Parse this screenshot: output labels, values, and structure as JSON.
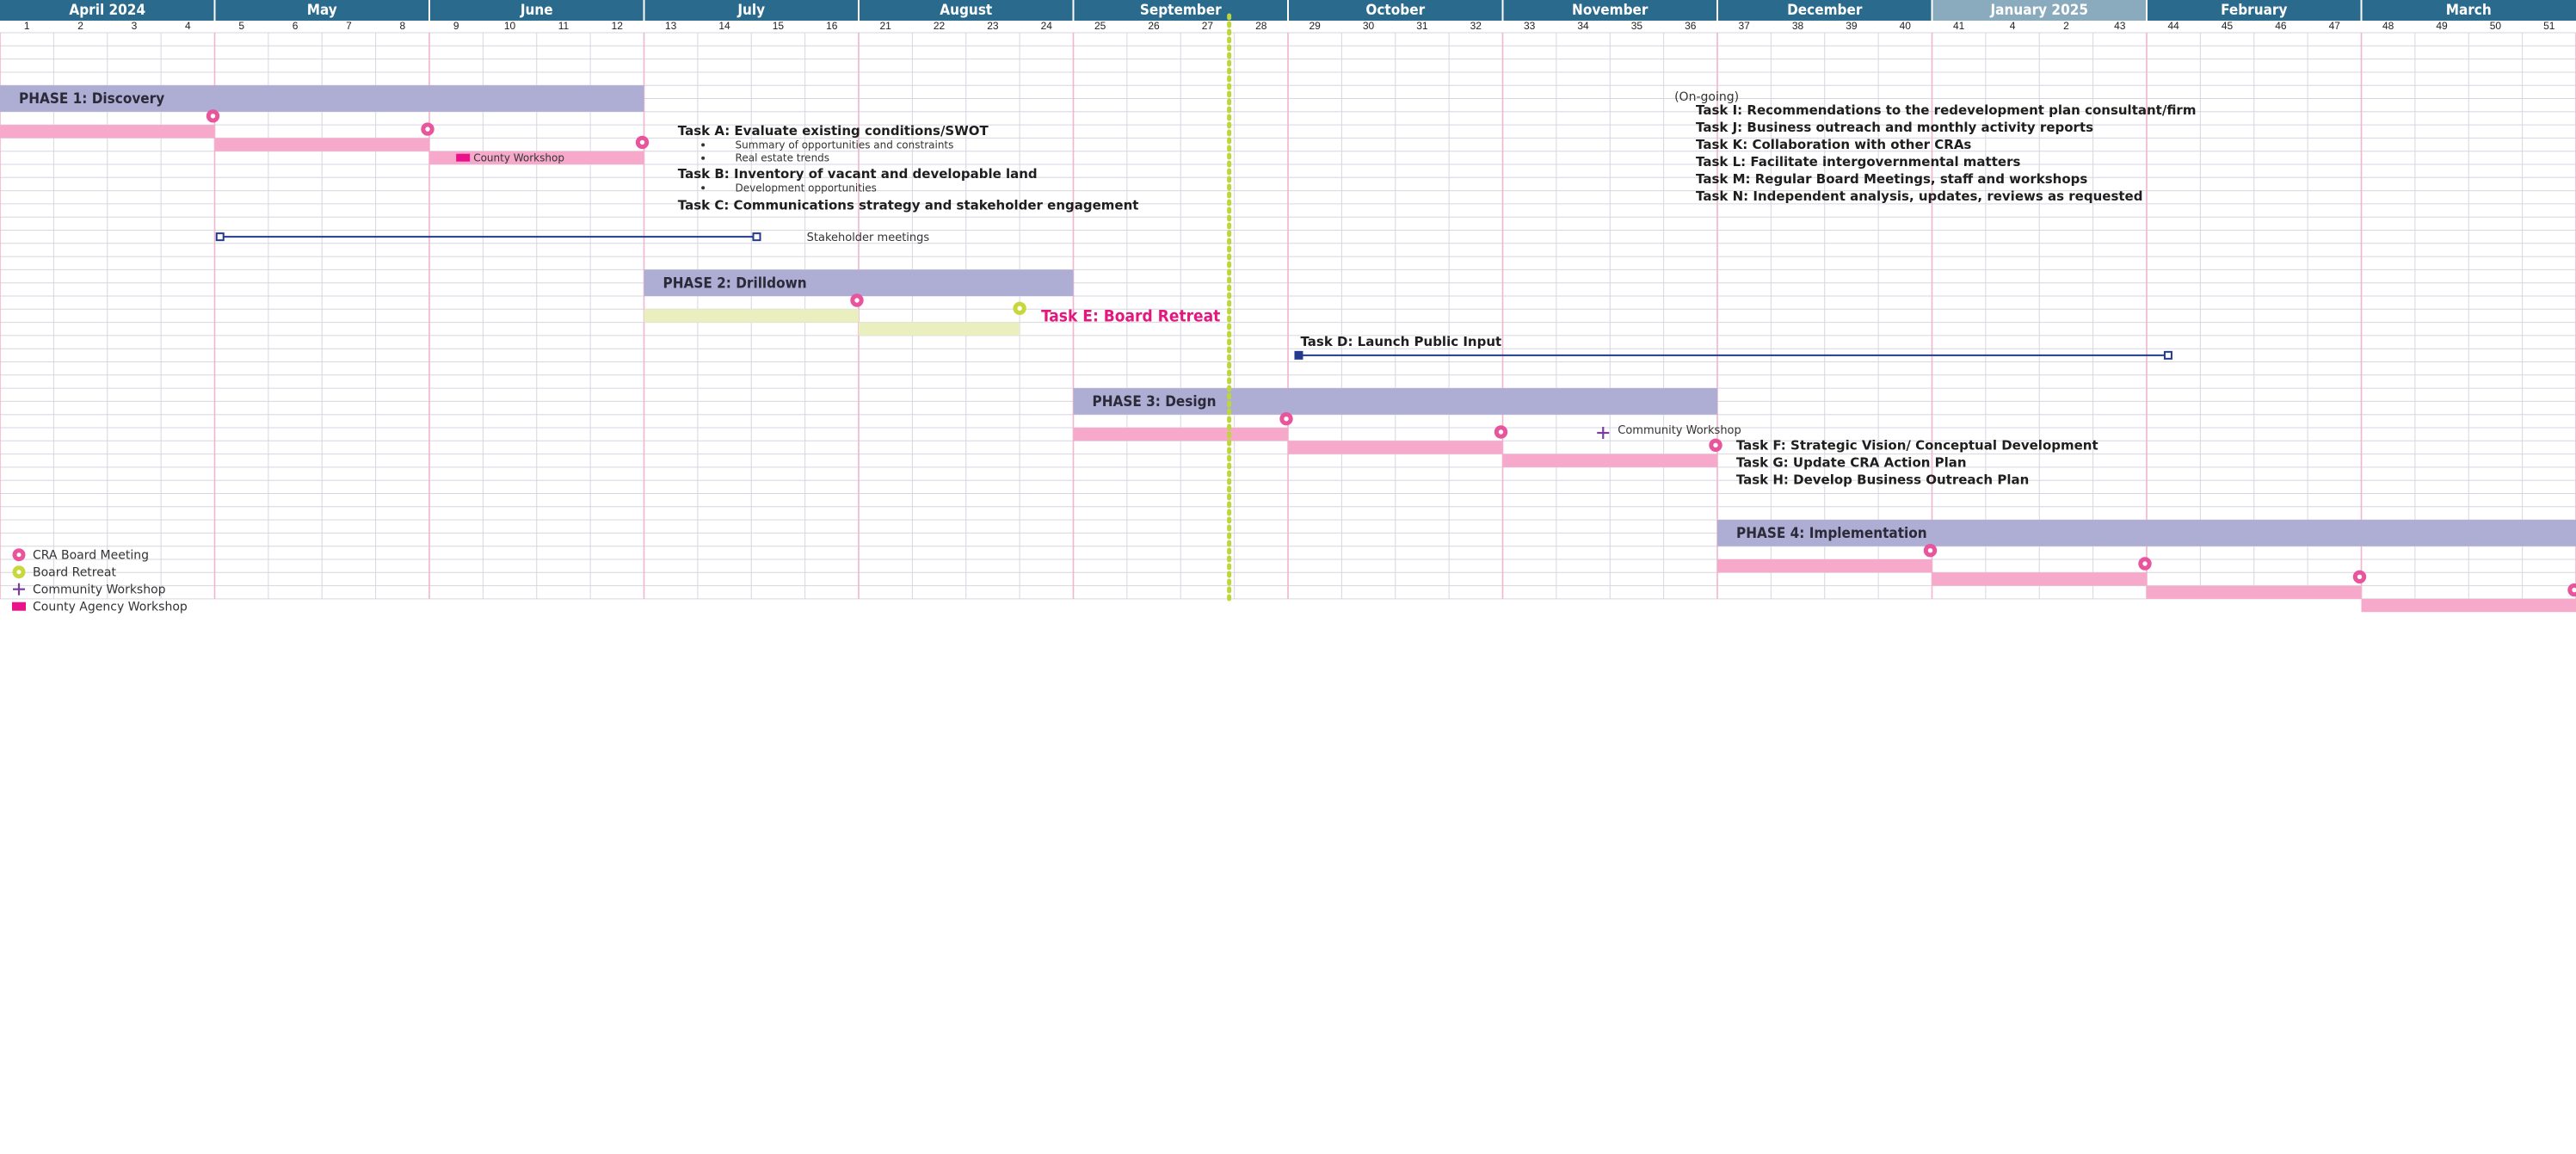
{
  "months": [
    {
      "label": "April 2024",
      "span": 4,
      "faded": false
    },
    {
      "label": "May",
      "span": 4,
      "faded": false
    },
    {
      "label": "June",
      "span": 4,
      "faded": false
    },
    {
      "label": "July",
      "span": 4,
      "faded": false
    },
    {
      "label": "August",
      "span": 4,
      "faded": false
    },
    {
      "label": "September",
      "span": 4,
      "faded": false
    },
    {
      "label": "October",
      "span": 4,
      "faded": false
    },
    {
      "label": "November",
      "span": 4,
      "faded": false
    },
    {
      "label": "December",
      "span": 4,
      "faded": false
    },
    {
      "label": "January 2025",
      "span": 4,
      "faded": true
    },
    {
      "label": "February",
      "span": 4,
      "faded": false
    },
    {
      "label": "March",
      "span": 4,
      "faded": false
    }
  ],
  "weeks": [
    "1",
    "2",
    "3",
    "4",
    "5",
    "6",
    "7",
    "8",
    "9",
    "10",
    "11",
    "12",
    "13",
    "14",
    "15",
    "16",
    "21",
    "22",
    "23",
    "24",
    "25",
    "26",
    "27",
    "28",
    "29",
    "30",
    "31",
    "32",
    "33",
    "34",
    "35",
    "36",
    "37",
    "38",
    "39",
    "40",
    "41",
    "4",
    "2",
    "43",
    "44",
    "45",
    "46",
    "47",
    "48",
    "49",
    "50",
    "51"
  ],
  "today_week": 23,
  "colors": {
    "header": "#2a6a8c",
    "header_faded": "#8aaabd",
    "phase": "#aeadd4",
    "meeting": "#e8559c",
    "meeting_bar": "#f7a9cb",
    "retreat": "#c8d83c",
    "retreat_bar": "#e9efbf",
    "community": "#7a3e9c",
    "county": "#e8128a",
    "line": "#233b8c",
    "today": "#bfd63a",
    "board_retreat_text": "#e3187f",
    "month_divider": "#f0b6cc",
    "grid": "#d6d6e0"
  },
  "phases": [
    {
      "label": "PHASE 1: Discovery",
      "start": 0,
      "end": 12,
      "row": 4
    },
    {
      "label": "PHASE 2: Drilldown",
      "start": 12,
      "end": 20,
      "row": 18
    },
    {
      "label": "PHASE 3: Design",
      "start": 20,
      "end": 32,
      "row": 27
    },
    {
      "label": "PHASE 4: Implementation",
      "start": 32,
      "end": 48,
      "row": 37
    }
  ],
  "bars": [
    {
      "start": 0,
      "end": 4,
      "row": 7,
      "kind": "meeting"
    },
    {
      "start": 4,
      "end": 8,
      "row": 8,
      "kind": "meeting"
    },
    {
      "start": 8,
      "end": 12,
      "row": 9,
      "kind": "meeting"
    },
    {
      "start": 12,
      "end": 16,
      "row": 21,
      "kind": "retreat"
    },
    {
      "start": 16,
      "end": 19,
      "row": 22,
      "kind": "retreat"
    },
    {
      "start": 20,
      "end": 24,
      "row": 30,
      "kind": "meeting"
    },
    {
      "start": 24,
      "end": 28,
      "row": 31,
      "kind": "meeting"
    },
    {
      "start": 28,
      "end": 32,
      "row": 32,
      "kind": "meeting"
    },
    {
      "start": 32,
      "end": 36,
      "row": 40,
      "kind": "meeting"
    },
    {
      "start": 36,
      "end": 40,
      "row": 41,
      "kind": "meeting"
    },
    {
      "start": 40,
      "end": 44,
      "row": 42,
      "kind": "meeting"
    },
    {
      "start": 44,
      "end": 48,
      "row": 43,
      "kind": "meeting"
    }
  ],
  "meetings": [
    {
      "week": 4,
      "row": 6
    },
    {
      "week": 8,
      "row": 7
    },
    {
      "week": 12,
      "row": 8
    },
    {
      "week": 16,
      "row": 20
    },
    {
      "week": 24,
      "row": 29
    },
    {
      "week": 28,
      "row": 30
    },
    {
      "week": 32,
      "row": 31
    },
    {
      "week": 36,
      "row": 39
    },
    {
      "week": 40,
      "row": 40
    },
    {
      "week": 44,
      "row": 41
    },
    {
      "week": 48,
      "row": 42
    }
  ],
  "retreats": [
    {
      "week": 19,
      "row": 21
    }
  ],
  "community_workshops": [
    {
      "week": 30,
      "row": 30,
      "label": "Community Workshop"
    }
  ],
  "county_workshops": [
    {
      "week": 8.5,
      "row": 9,
      "label": "County Workshop"
    }
  ],
  "spans": [
    {
      "start": 4.1,
      "end": 14.1,
      "row": 15,
      "start_filled": false,
      "label": "Stakeholder meetings",
      "label_week": 15
    }
  ],
  "task_d": {
    "title": "Task D: Launch Public Input",
    "start": 24.2,
    "end": 40.4,
    "row": 24
  },
  "board_retreat_label": "Task E: Board Retreat",
  "phase1_tasks": [
    {
      "kind": "title",
      "text": "Task A: Evaluate existing conditions/SWOT"
    },
    {
      "kind": "bullet",
      "text": "Summary of opportunities and constraints"
    },
    {
      "kind": "bullet",
      "text": "Real estate trends"
    },
    {
      "kind": "title",
      "text": "Task B: Inventory of vacant and developable land"
    },
    {
      "kind": "bullet",
      "text": "Development opportunities"
    },
    {
      "kind": "title",
      "text": "Task C: Communications strategy and stakeholder engagement"
    }
  ],
  "ongoing": {
    "heading": "(On-going)",
    "tasks": [
      "Task I: Recommendations to the redevelopment plan consultant/firm",
      "Task J: Business outreach and monthly activity reports",
      "Task K: Collaboration with other CRAs",
      "Task L: Facilitate intergovernmental matters",
      "Task M: Regular Board Meetings, staff and workshops",
      "Task N: Independent analysis, updates, reviews as requested"
    ]
  },
  "phase3_tasks": [
    "Task F: Strategic Vision/ Conceptual Development",
    "Task G: Update CRA Action Plan",
    "Task H: Develop Business Outreach Plan"
  ],
  "legend": [
    {
      "kind": "meeting",
      "label": "CRA Board Meeting"
    },
    {
      "kind": "retreat",
      "label": "Board Retreat"
    },
    {
      "kind": "community",
      "label": "Community Workshop"
    },
    {
      "kind": "county",
      "label": "County Agency Workshop"
    }
  ]
}
